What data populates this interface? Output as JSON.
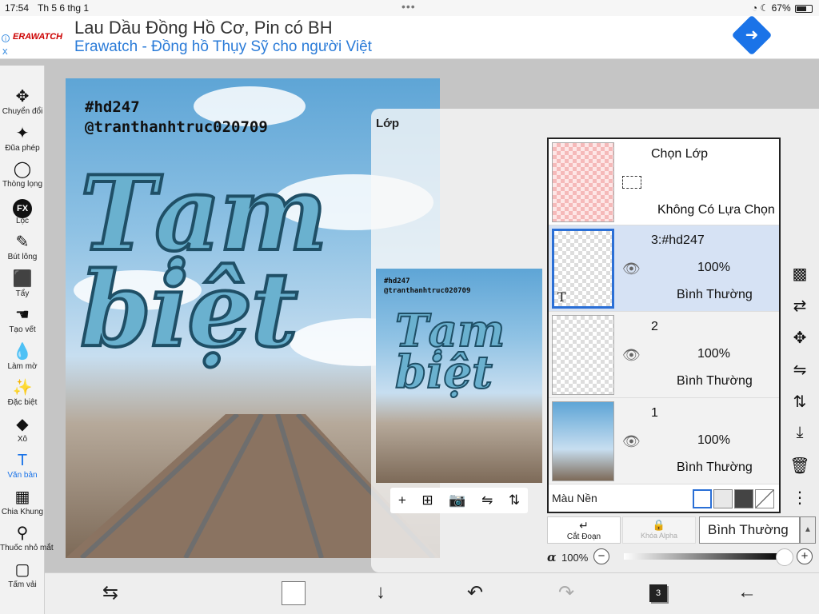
{
  "status": {
    "time": "17:54",
    "date": "Th 5 6 thg 1",
    "battery": "67%"
  },
  "ad": {
    "logo": "ERAWATCH",
    "title": "Lau Dầu Đồng Hồ Cơ, Pin có BH",
    "subtitle": "Erawatch - Đồng hồ Thụy Sỹ cho người Việt",
    "info_icon": "info-icon",
    "close": "x"
  },
  "tools": [
    {
      "id": "move",
      "label": "Chuyển đổi",
      "icon": "✥"
    },
    {
      "id": "wand",
      "label": "Đũa phép",
      "icon": "✦"
    },
    {
      "id": "lasso",
      "label": "Thòng lọng",
      "icon": "◯"
    },
    {
      "id": "filter",
      "label": "Lọc",
      "icon": "FX"
    },
    {
      "id": "brush",
      "label": "Bút lông",
      "icon": "✎"
    },
    {
      "id": "eraser",
      "label": "Tẩy",
      "icon": "⬛"
    },
    {
      "id": "smudge",
      "label": "Tạo vết",
      "icon": "☚"
    },
    {
      "id": "blur",
      "label": "Làm mờ",
      "icon": "💧"
    },
    {
      "id": "special",
      "label": "Đặc biệt",
      "icon": "✨"
    },
    {
      "id": "fill",
      "label": "Xô",
      "icon": "◆"
    },
    {
      "id": "text",
      "label": "Văn bản",
      "icon": "T",
      "active": true
    },
    {
      "id": "divide",
      "label": "Chia Khung",
      "icon": "▦"
    },
    {
      "id": "eyedropper",
      "label": "Thuốc nhỏ mắt",
      "icon": "⚲"
    },
    {
      "id": "canvas",
      "label": "Tấm vải",
      "icon": "▢"
    }
  ],
  "canvas": {
    "hashtag": "#hd247",
    "handle": "@tranthanhtruc020709",
    "big_line1": "Tạm",
    "big_line2": "biệt"
  },
  "layer_panel": {
    "title": "Lớp",
    "selection": {
      "name": "Chọn Lớp",
      "status": "Không Có Lựa Chọn"
    },
    "layers": [
      {
        "name": "3:#hd247",
        "opacity": "100%",
        "mode": "Bình Thường",
        "selected": true,
        "thumb_text": "T"
      },
      {
        "name": "2",
        "opacity": "100%",
        "mode": "Bình Thường",
        "selected": false
      },
      {
        "name": "1",
        "opacity": "100%",
        "mode": "Bình Thường",
        "selected": false
      }
    ],
    "background_label": "Màu Nền",
    "cut_label": "Cắt Đoạn",
    "alpha_lock_label": "Khóa Alpha",
    "blend_mode": "Bình Thường",
    "alpha_symbol": "α",
    "alpha_value": "100%",
    "alpha_fraction": 1.0
  },
  "bottom": {
    "layer_count": "3"
  }
}
